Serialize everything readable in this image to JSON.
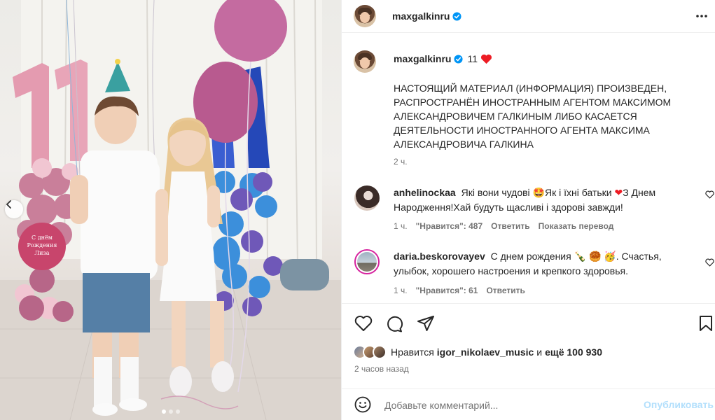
{
  "colors": {
    "accent_blue": "#0095f6",
    "publish_disabled": "#b2dffc",
    "heart_red": "#ed1c24",
    "muted_text": "#737373",
    "border": "#efefef"
  },
  "post": {
    "author": "maxgalkinru",
    "caption_suffix": "11",
    "caption_text": "НАСТОЯЩИЙ МАТЕРИАЛ (ИНФОРМАЦИЯ) ПРОИЗВЕДЕН, РАСПРОСТРАНЁН ИНОСТРАННЫМ АГЕНТОМ МАКСИМОМ АЛЕКСАНДРОВИЧЕМ ГАЛКИНЫМ ЛИБО КАСАЕТСЯ ДЕЯТЕЛЬНОСТИ ИНОСТРАННОГО АГЕНТА МАКСИМА АЛЕКСАНДРОВИЧА ГАЛКИНА",
    "caption_time": "2 ч.",
    "icons": [
      "verified-badge-icon",
      "more-icon",
      "heart-emoji-icon"
    ]
  },
  "photo": {
    "balloon_text_line1": "С днём",
    "balloon_text_line2": "Рождения",
    "balloon_text_line3": "Лиза",
    "carousel_dots": 3,
    "active_dot": 0
  },
  "comments": [
    {
      "user": "anhelinockaa",
      "text_a": "Які вони чудові",
      "text_b": "Як і їхні батьки",
      "text_c": "З Днем Народження!Хай будуть щасливі і здорові завжди!",
      "time": "1 ч.",
      "likes": "\"Нравится\": 487",
      "reply": "Ответить",
      "translate": "Показать перевод"
    },
    {
      "user": "daria.beskorovayev",
      "text_a": "С днем рождения",
      "text_b": ". Счастья, улыбок, хорошего настроения и крепкого здоровья.",
      "time": "1 ч.",
      "likes": "\"Нравится\": 61",
      "reply": "Ответить"
    }
  ],
  "actions": {
    "icons": [
      "heart-icon",
      "comment-icon",
      "share-icon",
      "bookmark-icon"
    ]
  },
  "likes": {
    "prefix": "Нравится",
    "user": "igor_nikolaev_music",
    "middle": "и",
    "count": "ещё 100 930"
  },
  "post_time": "2 часов назад",
  "add_comment": {
    "placeholder": "Добавьте комментарий...",
    "publish": "Опубликовать"
  }
}
